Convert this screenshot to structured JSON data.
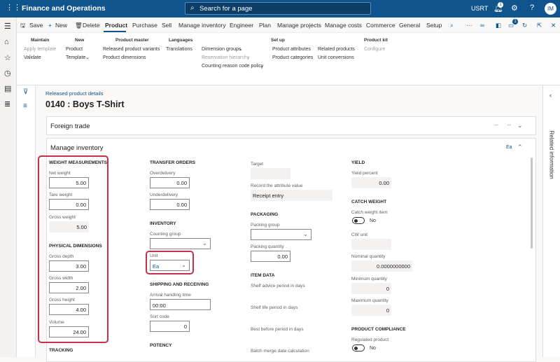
{
  "topbar": {
    "app_title": "Finance and Operations",
    "search_placeholder": "Search for a page",
    "company": "USRT",
    "notification_count": "1",
    "avatar_initials": "IM"
  },
  "actionbar": {
    "save": "Save",
    "new": "New",
    "delete": "Delete",
    "tabs": [
      "Product",
      "Purchase",
      "Sell",
      "Manage inventory",
      "Engineer",
      "Plan",
      "Manage projects",
      "Manage costs",
      "Commerce",
      "General",
      "Setup"
    ],
    "more": "···",
    "counter": "1"
  },
  "ribbon": {
    "maintain": {
      "header": "Maintain",
      "items": [
        "Apply template",
        "Validate"
      ]
    },
    "new": {
      "header": "New",
      "items": [
        "Product",
        "Template"
      ]
    },
    "product_master": {
      "header": "Product master",
      "items": [
        "Released product variants",
        "Product dimensions"
      ]
    },
    "languages": {
      "header": "Languages",
      "items": [
        "Translations"
      ]
    },
    "dimensions": {
      "items": [
        "Dimension groups",
        "Reservation hierarchy",
        "Counting reason code policy"
      ]
    },
    "setup": {
      "header": "Set up",
      "items": [
        "Product attributes",
        "Product categories",
        "Related products",
        "Unit conversions"
      ]
    },
    "product_kit": {
      "header": "Product kit",
      "items": [
        "Configure"
      ]
    }
  },
  "page": {
    "breadcrumb": "Released product details",
    "title": "0140 : Boys T-Shirt"
  },
  "foreign_trade": {
    "header": "Foreign trade",
    "summary1": "--",
    "summary2": "--"
  },
  "manage_inventory": {
    "header": "Manage inventory",
    "summary": "Ea",
    "weight": {
      "title": "WEIGHT MEASUREMENTS",
      "net_label": "Net weight",
      "net": "5.00",
      "tare_label": "Tare weight",
      "tare": "0.00",
      "gross_label": "Gross weight",
      "gross": "5.00"
    },
    "physical": {
      "title": "PHYSICAL DIMENSIONS",
      "depth_label": "Gross depth",
      "depth": "3.00",
      "width_label": "Gross width",
      "width": "2.00",
      "height_label": "Gross height",
      "height": "4.00",
      "volume_label": "Volume",
      "volume": "24.00"
    },
    "tracking_title": "TRACKING",
    "transfer": {
      "title": "TRANSFER ORDERS",
      "over_label": "Overdelivery",
      "over": "0.00",
      "under_label": "Underdelivery",
      "under": "0.00"
    },
    "inventory": {
      "title": "INVENTORY",
      "counting_label": "Counting group",
      "counting": "",
      "unit_label": "Unit",
      "unit": "Ea"
    },
    "shipping": {
      "title": "SHIPPING AND RECEIVING",
      "arrival_label": "Arrival handling time",
      "arrival": "00:00",
      "sort_label": "Sort code",
      "sort": "0"
    },
    "potency_title": "POTENCY",
    "target": {
      "target_label": "Target",
      "target": "",
      "record_label": "Record the attribute value",
      "record": "Receipt entry"
    },
    "packaging": {
      "title": "PACKAGING",
      "group_label": "Packing group",
      "group": "",
      "qty_label": "Packing quantity",
      "qty": "0.00"
    },
    "item_data": {
      "title": "ITEM DATA",
      "shelf_advice_label": "Shelf advice period in days",
      "shelf_life_label": "Shelf life period in days",
      "best_before_label": "Best before period in days",
      "batch_merge_label": "Batch merge date calculation"
    },
    "yield": {
      "title": "YIELD",
      "percent_label": "Yield percent",
      "percent": "0.00"
    },
    "catch_weight": {
      "title": "CATCH WEIGHT",
      "item_label": "Catch weight item",
      "item_value": "No",
      "cw_unit_label": "CW unit",
      "cw_unit": "",
      "nominal_label": "Nominal quantity",
      "nominal": "0.0000000000",
      "min_label": "Minimum quantity",
      "min": "0",
      "max_label": "Maximum quantity",
      "max": "0"
    },
    "compliance": {
      "title": "PRODUCT COMPLIANCE",
      "regulated_label": "Regulated product",
      "regulated_value": "No"
    }
  },
  "related": {
    "label": "Related information"
  },
  "colors": {
    "brand": "#0f548c",
    "highlight": "#c5304a"
  }
}
